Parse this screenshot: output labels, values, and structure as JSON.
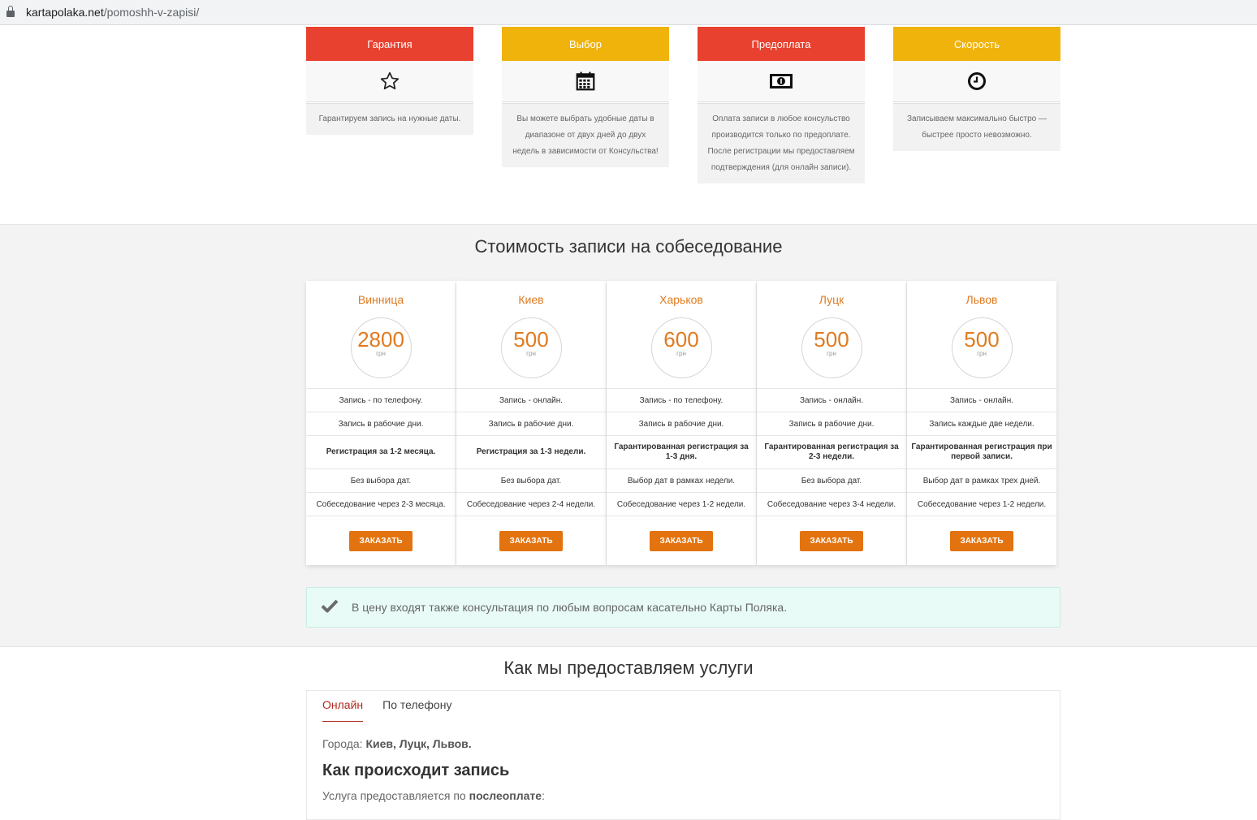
{
  "browser": {
    "url_domain": "kartapolaka.net",
    "url_path": "/pomoshh-v-zapisi/"
  },
  "features": [
    {
      "title": "Гарантия",
      "icon": "star-icon",
      "text": "Гарантируем запись на нужные даты."
    },
    {
      "title": "Выбор",
      "icon": "calendar-icon",
      "text": "Вы можете выбрать удобные даты в диапазоне от двух дней до двух недель в зависимости от Консульства!"
    },
    {
      "title": "Предоплата",
      "icon": "money-icon",
      "text": "Оплата записи в любое консульство производится только по предоплате. После регистрации мы предоставляем подтверждения (для онлайн записи)."
    },
    {
      "title": "Скорость",
      "icon": "clock-icon",
      "text": "Записываем максимально быстро — быстрее просто невозможно."
    }
  ],
  "colors": {
    "red": "#e8412f",
    "yellow": "#f0b30c",
    "orange": "#e3730e",
    "note_bg": "#e8fbf6"
  },
  "pricing": {
    "title": "Стоимость записи на собеседование",
    "order_label": "ЗАКАЗАТЬ",
    "cards": [
      {
        "city": "Винница",
        "price": "2800",
        "currency": "грн",
        "features": [
          "Запись - по телефону.",
          "Запись в рабочие дни.",
          "Регистрация за 1-2 месяца.",
          "Без выбора дат.",
          "Собеседование через 2-3 месяца."
        ]
      },
      {
        "city": "Киев",
        "price": "500",
        "currency": "грн",
        "features": [
          "Запись - онлайн.",
          "Запись в рабочие дни.",
          "Регистрация за 1-3 недели.",
          "Без выбора дат.",
          "Собеседование через 2-4 недели."
        ]
      },
      {
        "city": "Харьков",
        "price": "600",
        "currency": "грн",
        "features": [
          "Запись - по телефону.",
          "Запись в рабочие дни.",
          "Гарантированная регистрация за 1-3 дня.",
          "Выбор дат в рамках недели.",
          "Собеседование через 1-2 недели."
        ]
      },
      {
        "city": "Луцк",
        "price": "500",
        "currency": "грн",
        "features": [
          "Запись - онлайн.",
          "Запись в рабочие дни.",
          "Гарантированная регистрация за 2-3 недели.",
          "Без выбора дат.",
          "Собеседование через 3-4 недели."
        ]
      },
      {
        "city": "Львов",
        "price": "500",
        "currency": "грн",
        "features": [
          "Запись - онлайн.",
          "Запись каждые две недели.",
          "Гарантированная регистрация при первой записи.",
          "Выбор дат в рамках трех дней.",
          "Собеседование через 1-2 недели."
        ]
      }
    ],
    "note": "В цену входят также консультация по любым вопросам касательно Карты Поляка."
  },
  "how": {
    "title": "Как мы предоставляем услуги",
    "tabs": [
      "Онлайн",
      "По телефону"
    ],
    "cities_label": "Города:",
    "cities_value": "Киев, Луцк, Львов.",
    "subtitle": "Как происходит запись",
    "service_prefix": "Услуга предоставляется по",
    "service_bold": "послеоплате",
    "service_suffix": ":"
  }
}
